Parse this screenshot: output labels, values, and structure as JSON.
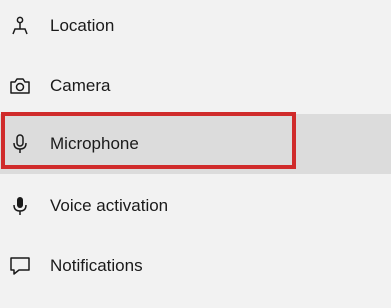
{
  "nav": {
    "items": [
      {
        "label": "Location",
        "icon": "location-icon"
      },
      {
        "label": "Camera",
        "icon": "camera-icon"
      },
      {
        "label": "Microphone",
        "icon": "microphone-icon",
        "selected": true
      },
      {
        "label": "Voice activation",
        "icon": "voice-activation-icon"
      },
      {
        "label": "Notifications",
        "icon": "notifications-icon"
      }
    ]
  },
  "colors": {
    "background": "#f2f2f2",
    "selected_background": "#dcdcdc",
    "highlight_border": "#d02b2b",
    "text": "#1a1a1a"
  }
}
